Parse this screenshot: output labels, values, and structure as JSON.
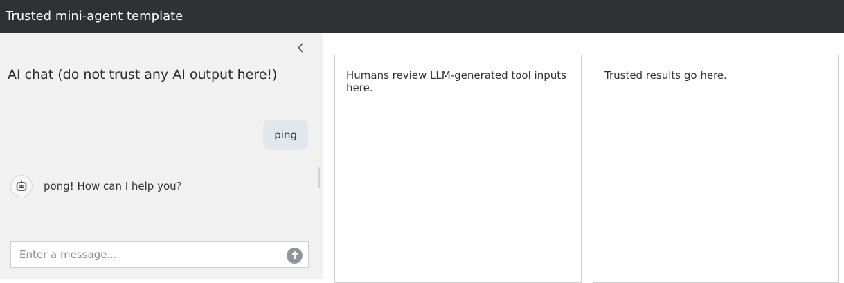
{
  "header": {
    "title": "Trusted mini-agent template"
  },
  "sidebar": {
    "collapse_icon": "chevron-left-icon",
    "title": "AI chat (do not trust any AI output here!)",
    "messages": [
      {
        "role": "user",
        "text": "ping"
      },
      {
        "role": "assistant",
        "icon": "robot-icon",
        "text": "pong! How can I help you?"
      }
    ],
    "input": {
      "placeholder": "Enter a message...",
      "value": "",
      "send_icon": "arrow-up-icon"
    }
  },
  "panels": {
    "review": {
      "text": "Humans review LLM-generated tool inputs here."
    },
    "results": {
      "text": "Trusted results go here."
    }
  }
}
